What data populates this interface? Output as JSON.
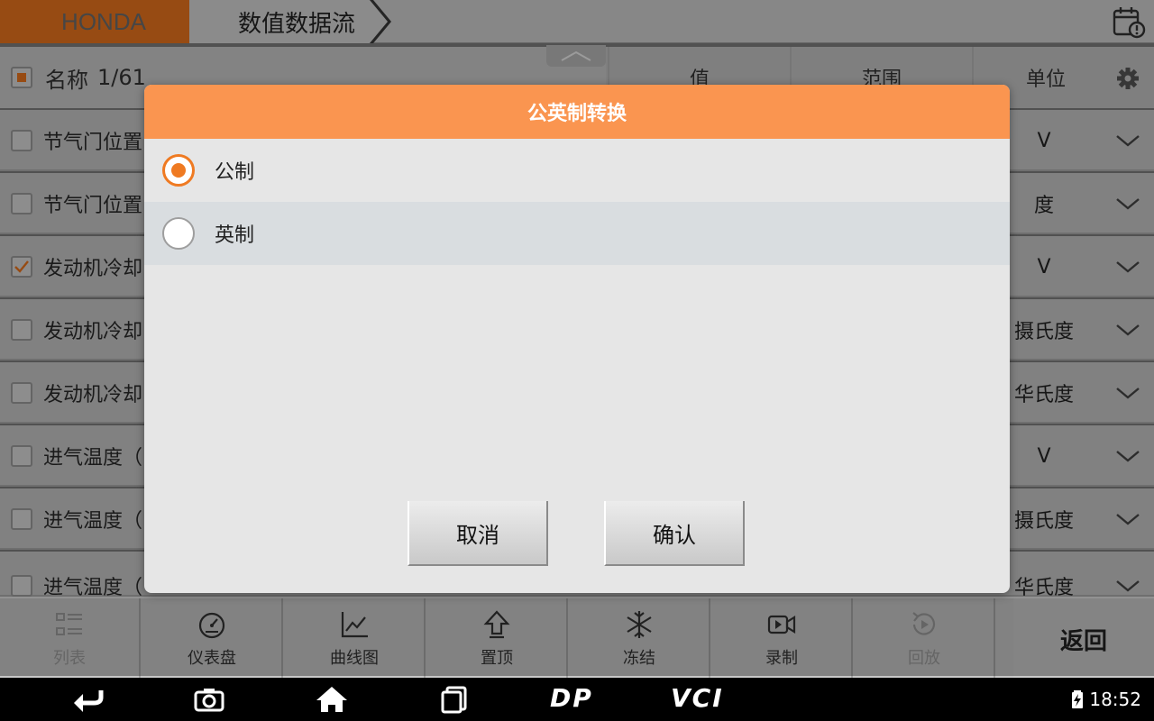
{
  "topbar": {
    "brand": "HONDA",
    "page_title": "数值数据流"
  },
  "table": {
    "header": {
      "name": "名称",
      "count": "1/61",
      "value": "值",
      "range": "范围",
      "unit": "单位"
    },
    "rows": [
      {
        "name": "节气门位置",
        "unit": "V",
        "checked": false
      },
      {
        "name": "节气门位置",
        "unit": "度",
        "checked": false
      },
      {
        "name": "发动机冷却",
        "unit": "V",
        "checked": true
      },
      {
        "name": "发动机冷却",
        "unit": "摄氏度",
        "checked": false
      },
      {
        "name": "发动机冷却",
        "unit": "华氏度",
        "checked": false
      },
      {
        "name": "进气温度（",
        "unit": "V",
        "checked": false
      },
      {
        "name": "进气温度（",
        "unit": "摄氏度",
        "checked": false
      },
      {
        "name": "进气温度（",
        "unit": "华氏度",
        "checked": false
      }
    ]
  },
  "dialog": {
    "title": "公英制转换",
    "options": [
      {
        "label": "公制",
        "selected": true
      },
      {
        "label": "英制",
        "selected": false
      }
    ],
    "cancel_label": "取消",
    "confirm_label": "确认"
  },
  "toolbar": {
    "list": "列表",
    "dashboard": "仪表盘",
    "graph": "曲线图",
    "pin_top": "置顶",
    "freeze": "冻结",
    "record": "录制",
    "playback": "回放",
    "back": "返回"
  },
  "navbar": {
    "dp_label": "DP",
    "vci_label": "VCI",
    "time": "18:52"
  },
  "colors": {
    "accent": "#ef7a22",
    "dialog_header": "#fa9550",
    "brand_tab": "#e8741e"
  }
}
